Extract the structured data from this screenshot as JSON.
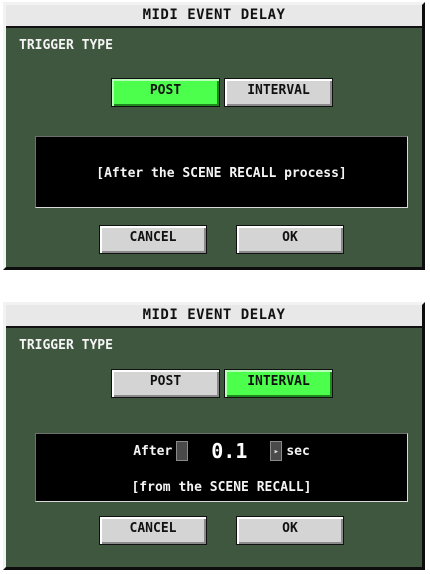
{
  "dialogs": [
    {
      "title": "MIDI EVENT DELAY",
      "trigger_type_label": "TRIGGER TYPE",
      "trigger_buttons": {
        "post": "POST",
        "interval": "INTERVAL",
        "selected": "POST"
      },
      "info_text": "[After the SCENE RECALL process]",
      "cancel_label": "CANCEL",
      "ok_label": "OK"
    },
    {
      "title": "MIDI EVENT DELAY",
      "trigger_type_label": "TRIGGER TYPE",
      "trigger_buttons": {
        "post": "POST",
        "interval": "INTERVAL",
        "selected": "INTERVAL"
      },
      "delay": {
        "prefix": "After",
        "value": "0.1",
        "unit": "sec"
      },
      "info_text": "[from the SCENE RECALL]",
      "cancel_label": "CANCEL",
      "ok_label": "OK"
    }
  ],
  "colors": {
    "panel": "#3f563f",
    "active_button": "#4cff4c",
    "button": "#d4d4d4",
    "title_bar": "#e8e8e8"
  }
}
